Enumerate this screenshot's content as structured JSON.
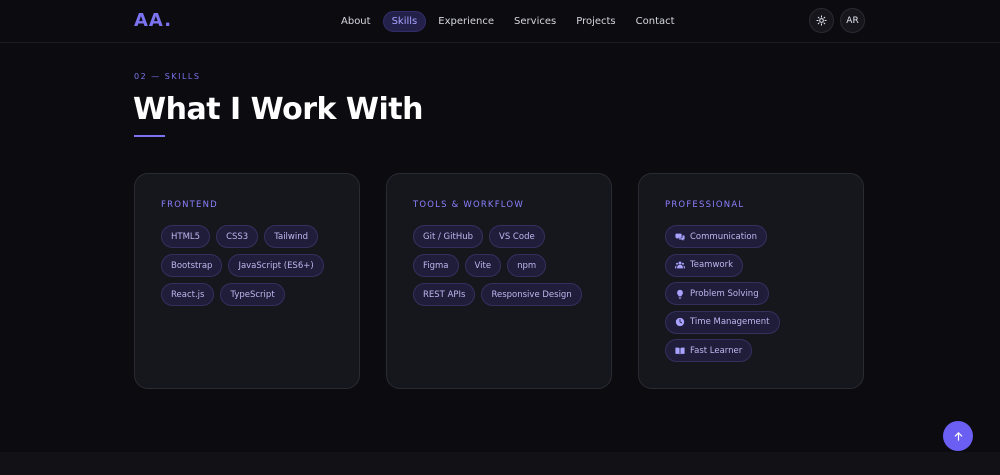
{
  "brand": {
    "logo": "AA."
  },
  "nav": {
    "links": [
      {
        "label": "About"
      },
      {
        "label": "Skills"
      },
      {
        "label": "Experience"
      },
      {
        "label": "Services"
      },
      {
        "label": "Projects"
      },
      {
        "label": "Contact"
      }
    ],
    "active": "Skills",
    "theme_icon": "sun-icon",
    "language_label": "AR"
  },
  "section": {
    "eyebrow": "02 — SKILLS",
    "title": "What I Work With"
  },
  "cards": [
    {
      "title": "FRONTEND",
      "chips": [
        "HTML5",
        "CSS3",
        "Tailwind",
        "Bootstrap",
        "JavaScript (ES6+)",
        "React.js",
        "TypeScript"
      ]
    },
    {
      "title": "TOOLS & WORKFLOW",
      "chips": [
        "Git / GitHub",
        "VS Code",
        "Figma",
        "Vite",
        "npm",
        "REST APIs",
        "Responsive Design"
      ]
    },
    {
      "title": "PROFESSIONAL",
      "chips": [
        {
          "label": "Communication",
          "icon": "chat-icon"
        },
        {
          "label": "Teamwork",
          "icon": "users-icon"
        },
        {
          "label": "Problem Solving",
          "icon": "lightbulb-icon"
        },
        {
          "label": "Time Management",
          "icon": "clock-icon"
        },
        {
          "label": "Fast Learner",
          "icon": "book-icon"
        }
      ]
    }
  ],
  "scroll_top_icon": "arrow-up-icon",
  "colors": {
    "background": "#0c0c10",
    "accent": "#7b73f0",
    "card": "#16161d",
    "chip": "#1f1d3a"
  }
}
